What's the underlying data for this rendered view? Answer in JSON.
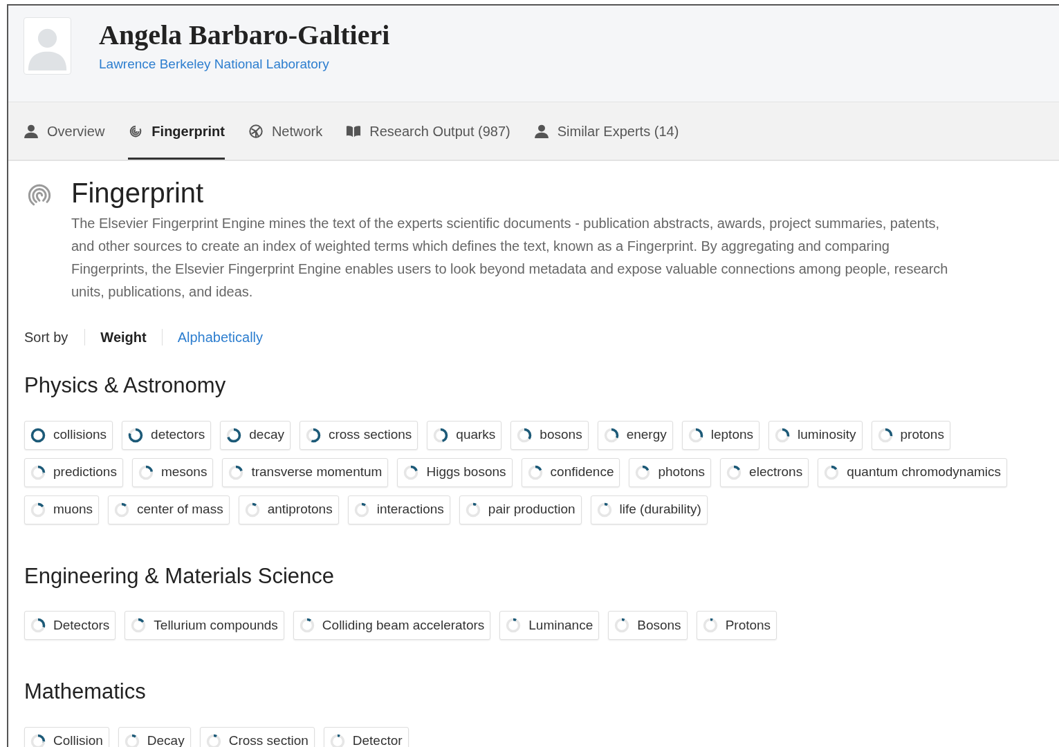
{
  "profile": {
    "name": "Angela Barbaro-Galtieri",
    "affiliation": "Lawrence Berkeley National Laboratory"
  },
  "tabs": [
    {
      "kind": "person",
      "label": "Overview",
      "selected": false
    },
    {
      "kind": "fingerprint",
      "label": "Fingerprint",
      "selected": true
    },
    {
      "kind": "network",
      "label": "Network",
      "selected": false
    },
    {
      "kind": "book",
      "label": "Research Output (987)",
      "selected": false
    },
    {
      "kind": "person",
      "label": "Similar Experts (14)",
      "selected": false
    }
  ],
  "section": {
    "title": "Fingerprint",
    "description_lines": [
      "The Elsevier Fingerprint Engine mines the text of the experts scientific documents - publication abstracts, awards, project summaries, patents,",
      "and other sources to create an index of weighted terms which defines the text, known as a Fingerprint. By aggregating and comparing",
      "Fingerprints, the Elsevier Fingerprint Engine enables users to look beyond metadata and expose valuable connections among people, research",
      "units, publications, and ideas."
    ]
  },
  "sort": {
    "label": "Sort by",
    "options": [
      {
        "label": "Weight",
        "selected": true
      },
      {
        "label": "Alphabetically",
        "selected": false
      }
    ]
  },
  "groups": [
    {
      "title": "Physics & Astronomy",
      "concepts": [
        {
          "label": "collisions",
          "level": 1.0
        },
        {
          "label": "detectors",
          "level": 0.8
        },
        {
          "label": "decay",
          "level": 0.7
        },
        {
          "label": "cross sections",
          "level": 0.55
        },
        {
          "label": "quarks",
          "level": 0.45
        },
        {
          "label": "bosons",
          "level": 0.35
        },
        {
          "label": "energy",
          "level": 0.32
        },
        {
          "label": "leptons",
          "level": 0.3
        },
        {
          "label": "luminosity",
          "level": 0.28
        },
        {
          "label": "protons",
          "level": 0.27
        },
        {
          "label": "predictions",
          "level": 0.25
        },
        {
          "label": "mesons",
          "level": 0.22
        },
        {
          "label": "transverse momentum",
          "level": 0.2
        },
        {
          "label": "Higgs bosons",
          "level": 0.2
        },
        {
          "label": "confidence",
          "level": 0.18
        },
        {
          "label": "photons",
          "level": 0.18
        },
        {
          "label": "electrons",
          "level": 0.17
        },
        {
          "label": "quantum chromodynamics",
          "level": 0.15
        },
        {
          "label": "muons",
          "level": 0.15
        },
        {
          "label": "center of mass",
          "level": 0.12
        },
        {
          "label": "antiprotons",
          "level": 0.1
        },
        {
          "label": "interactions",
          "level": 0.1
        },
        {
          "label": "pair production",
          "level": 0.08
        },
        {
          "label": "life (durability)",
          "level": 0.08
        }
      ]
    },
    {
      "title": "Engineering & Materials Science",
      "concepts": [
        {
          "label": "Detectors",
          "level": 0.3
        },
        {
          "label": "Tellurium compounds",
          "level": 0.15
        },
        {
          "label": "Colliding beam accelerators",
          "level": 0.1
        },
        {
          "label": "Luminance",
          "level": 0.08
        },
        {
          "label": "Bosons",
          "level": 0.07
        },
        {
          "label": "Protons",
          "level": 0.06
        }
      ]
    },
    {
      "title": "Mathematics",
      "concepts": [
        {
          "label": "Collision",
          "level": 0.25
        },
        {
          "label": "Decay",
          "level": 0.1
        },
        {
          "label": "Cross section",
          "level": 0.08
        },
        {
          "label": "Detector",
          "level": 0.06
        }
      ]
    }
  ]
}
